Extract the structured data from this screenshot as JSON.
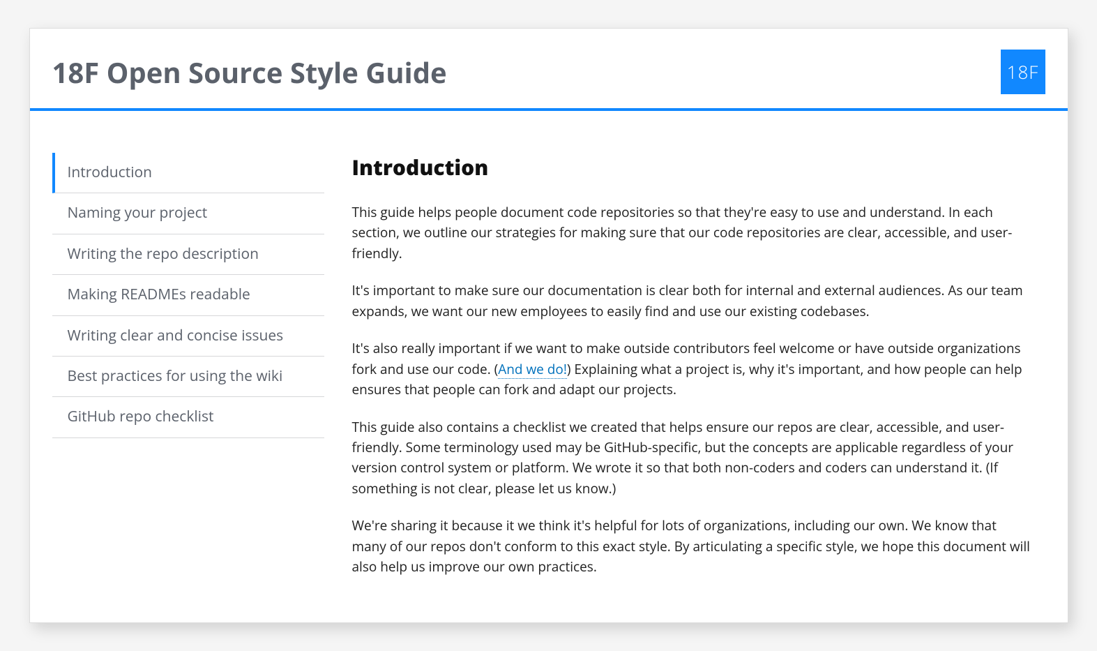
{
  "header": {
    "title": "18F Open Source Style Guide",
    "logo_text": "18F"
  },
  "sidebar": {
    "items": [
      {
        "label": "Introduction",
        "active": true
      },
      {
        "label": "Naming your project",
        "active": false
      },
      {
        "label": "Writing the repo description",
        "active": false
      },
      {
        "label": "Making READMEs readable",
        "active": false
      },
      {
        "label": "Writing clear and concise issues",
        "active": false
      },
      {
        "label": "Best practices for using the wiki",
        "active": false
      },
      {
        "label": "GitHub repo checklist",
        "active": false
      }
    ]
  },
  "content": {
    "heading": "Introduction",
    "p1": "This guide helps people document code repositories so that they're easy to use and understand. In each section, we outline our strategies for making sure that our code repositories are clear, accessible, and user-friendly.",
    "p2": "It's important to make sure our documentation is clear both for internal and external audiences. As our team expands, we want our new employees to easily find and use our existing codebases.",
    "p3_pre": "It's also really important if we want to make outside contributors feel welcome or have outside organizations fork and use our code. (",
    "p3_link": "And we do!",
    "p3_post": ") Explaining what a project is, why it's important, and how people can help ensures that people can fork and adapt our projects.",
    "p4": "This guide also contains a checklist we created that helps ensure our repos are clear, accessible, and user-friendly. Some terminology used may be GitHub-specific, but the concepts are applicable regardless of your version control system or platform. We wrote it so that both non-coders and coders can understand it. (If something is not clear, please let us know.)",
    "p5": "We're sharing it because it we think it's helpful for lots of organizations, including our own. We know that many of our repos don't conform to this exact style. By articulating a specific style, we hope this document will also help us improve our own practices."
  }
}
